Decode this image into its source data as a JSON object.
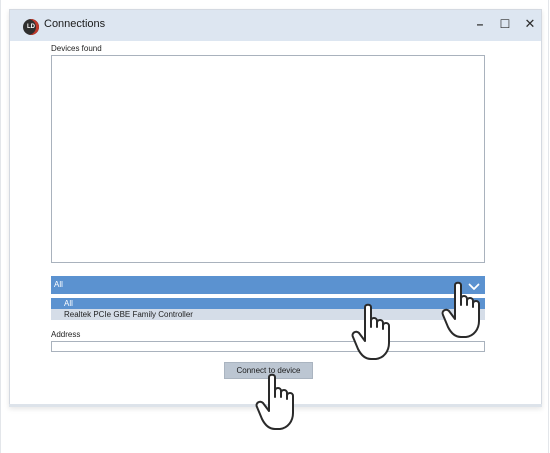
{
  "window": {
    "title": "Connections",
    "logo_text": "LD",
    "minimize_glyph": "–",
    "maximize_glyph": "☐",
    "close_glyph": "✕"
  },
  "devices": {
    "label": "Devices found",
    "items": []
  },
  "adapter_select": {
    "selected": "All",
    "options": [
      "All",
      "Realtek PCIe GBE Family Controller"
    ]
  },
  "address": {
    "label": "Address",
    "value": ""
  },
  "connect_button": {
    "label": "Connect to device"
  },
  "colors": {
    "titlebar": "#dde6f1",
    "selection": "#5b92d0",
    "option_hover": "#d5dde8",
    "button": "#bcc6d2"
  },
  "icons": [
    "pointing-hand-cursor-icon",
    "chevron-down-icon",
    "app-logo-icon"
  ]
}
